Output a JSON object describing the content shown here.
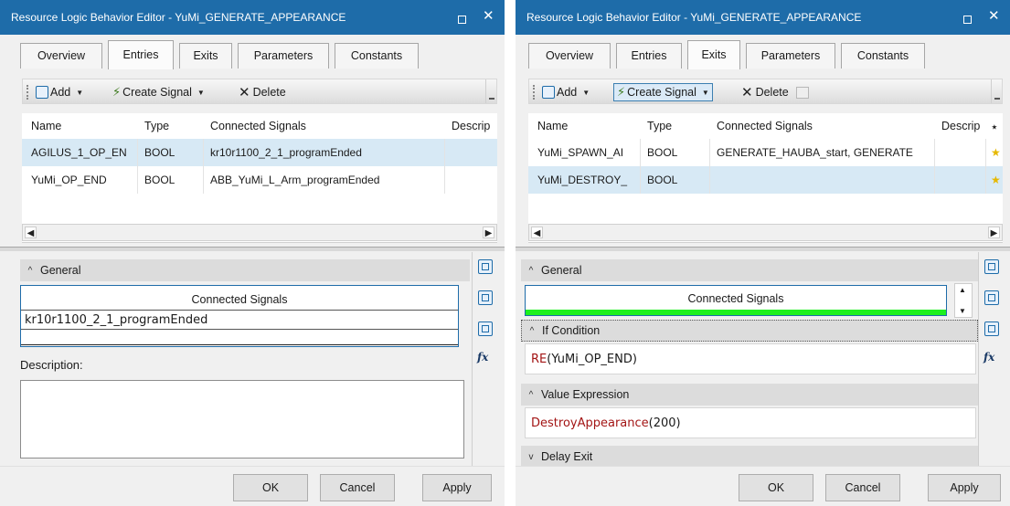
{
  "left": {
    "title": "Resource Logic Behavior Editor - YuMi_GENERATE_APPEARANCE",
    "tabs": [
      "Overview",
      "Entries",
      "Exits",
      "Parameters",
      "Constants"
    ],
    "active_tab": "Entries",
    "toolbar": {
      "add": "Add",
      "create_signal": "Create Signal",
      "delete": "Delete"
    },
    "columns": [
      "Name",
      "Type",
      "Connected Signals",
      "Descrip"
    ],
    "rows": [
      {
        "name": "AGILUS_1_OP_EN",
        "type": "BOOL",
        "signals": "kr10r1100_2_1_programEnded"
      },
      {
        "name": "YuMi_OP_END",
        "type": "BOOL",
        "signals": "ABB_YuMi_L_Arm_programEnded"
      }
    ],
    "general_label": "General",
    "connected_signals_header": "Connected Signals",
    "connected_signal_value": "kr10r1100_2_1_programEnded",
    "description_label": "Description:",
    "buttons": {
      "ok": "OK",
      "cancel": "Cancel",
      "apply": "Apply"
    }
  },
  "right": {
    "title": "Resource Logic Behavior Editor - YuMi_GENERATE_APPEARANCE",
    "tabs": [
      "Overview",
      "Entries",
      "Exits",
      "Parameters",
      "Constants"
    ],
    "active_tab": "Exits",
    "toolbar": {
      "add": "Add",
      "create_signal": "Create Signal",
      "delete": "Delete"
    },
    "columns": [
      "Name",
      "Type",
      "Connected Signals",
      "Descrip"
    ],
    "rows": [
      {
        "name": "YuMi_SPAWN_AI",
        "type": "BOOL",
        "signals": "GENERATE_HAUBA_start, GENERATE"
      },
      {
        "name": "YuMi_DESTROY_",
        "type": "BOOL",
        "signals": ""
      }
    ],
    "general_label": "General",
    "connected_signals_header": "Connected Signals",
    "if_condition_label": "If Condition",
    "if_condition_fn": "RE",
    "if_condition_arg": "(YuMi_OP_END)",
    "value_expression_label": "Value Expression",
    "value_expression_fn": "DestroyAppearance",
    "value_expression_arg": "(200)",
    "delay_exit_label": "Delay Exit",
    "buttons": {
      "ok": "OK",
      "cancel": "Cancel",
      "apply": "Apply"
    }
  },
  "colors": {
    "titlebar": "#1e6ca9",
    "selected_row": "#d7e9f5",
    "green_bar": "#1ef01e",
    "expr_red": "#a31515"
  }
}
